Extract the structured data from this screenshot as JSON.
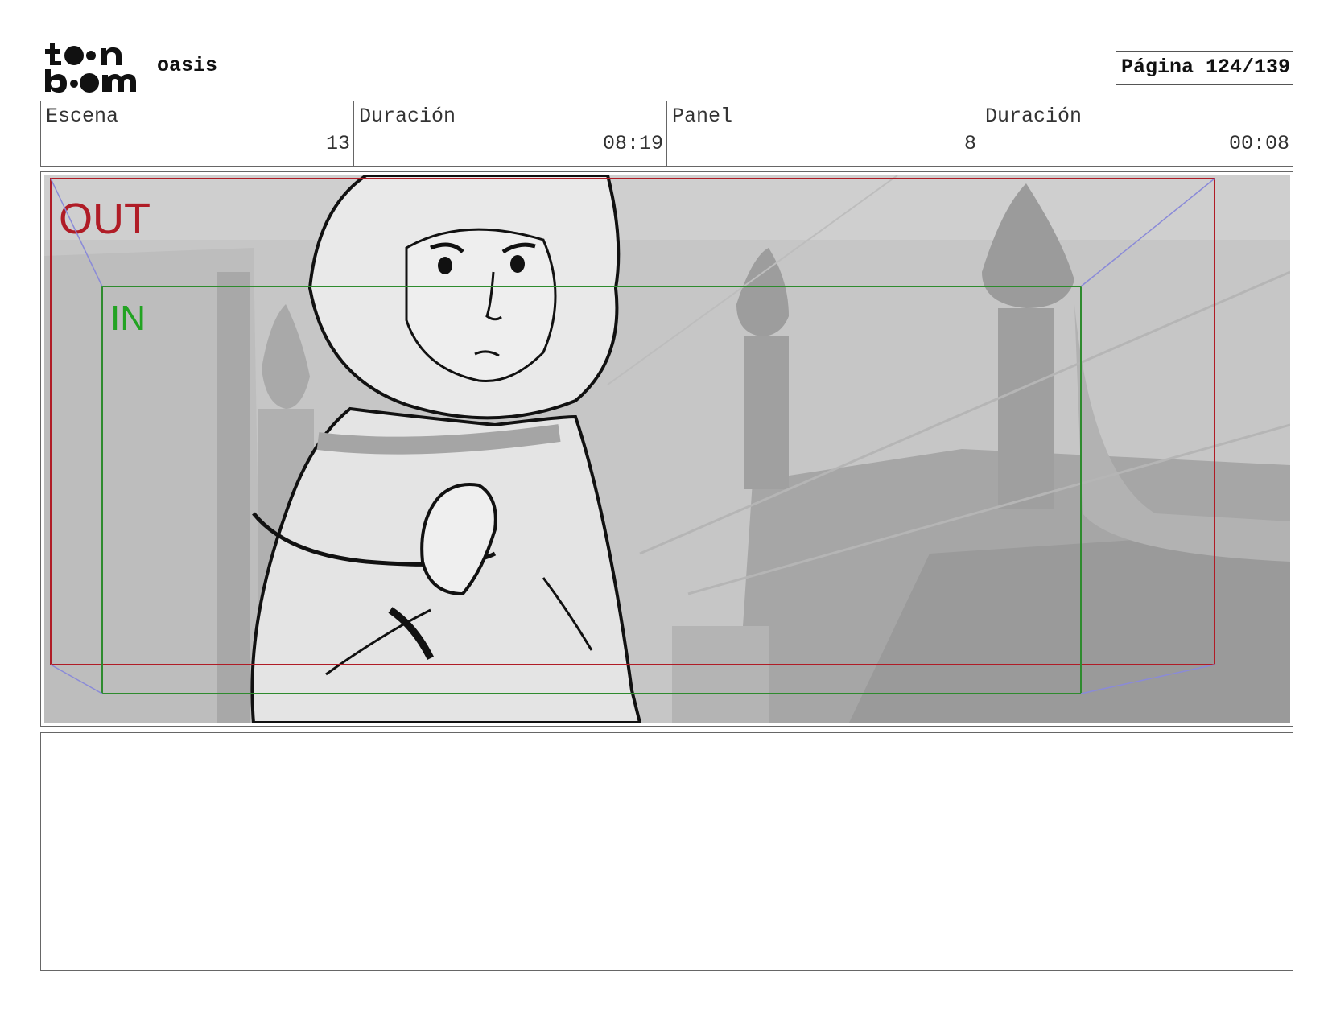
{
  "header": {
    "logo_top": "t●●n",
    "logo_bottom": "b●●m",
    "project_name": "oasis",
    "page_label": "Página 124/139"
  },
  "info": {
    "scene_label": "Escena",
    "scene_value": "13",
    "scene_duration_label": "Duración",
    "scene_duration_value": "08:19",
    "panel_label": "Panel",
    "panel_value": "8",
    "panel_duration_label": "Duración",
    "panel_duration_value": "00:08"
  },
  "frame": {
    "out_label": "OUT",
    "in_label": "IN",
    "out_color": "#b01c26",
    "in_color": "#2e8b2e",
    "guide_color": "#8a8ad8"
  },
  "notes": {
    "text": ""
  }
}
